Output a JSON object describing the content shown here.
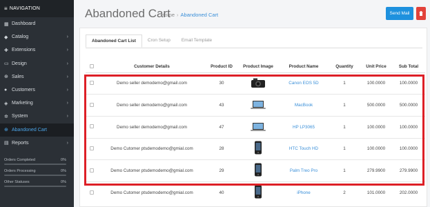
{
  "sidebar": {
    "header": "NAVIGATION",
    "items": [
      {
        "label": "Dashboard",
        "icon": "dashboard-icon",
        "chevron": false
      },
      {
        "label": "Catalog",
        "icon": "tag-icon",
        "chevron": true
      },
      {
        "label": "Extensions",
        "icon": "puzzle-icon",
        "chevron": true
      },
      {
        "label": "Design",
        "icon": "monitor-icon",
        "chevron": true
      },
      {
        "label": "Sales",
        "icon": "cart-icon",
        "chevron": true
      },
      {
        "label": "Customers",
        "icon": "user-icon",
        "chevron": true
      },
      {
        "label": "Marketing",
        "icon": "share-icon",
        "chevron": true
      },
      {
        "label": "System",
        "icon": "gear-icon",
        "chevron": true
      },
      {
        "label": "Abandoned Cart",
        "icon": "cart-icon",
        "chevron": false
      },
      {
        "label": "Reports",
        "icon": "chart-icon",
        "chevron": true
      }
    ],
    "stats": [
      {
        "label": "Orders Completed",
        "value": "0%"
      },
      {
        "label": "Orders Processing",
        "value": "0%"
      },
      {
        "label": "Other Statuses",
        "value": "0%"
      }
    ]
  },
  "header": {
    "title": "Abandoned Cart",
    "breadcrumb_home": "Home",
    "breadcrumb_sep": "›",
    "breadcrumb_current": "Abandoned Cart",
    "send_mail_label": "Send Mail"
  },
  "tabs": [
    "Abandoned Cart List",
    "Cron Setup",
    "Email Template"
  ],
  "table": {
    "headers": [
      "Customer Details",
      "Product ID",
      "Product Image",
      "Product Name",
      "Quantity",
      "Unit Price",
      "Sub Total"
    ],
    "rows": [
      {
        "customer": "Demo seller demodemo@gmail.com",
        "product_id": "30",
        "image": "camera-icon",
        "name": "Canon EOS 5D",
        "qty": "1",
        "unit": "100.0000",
        "sub": "100.0000"
      },
      {
        "customer": "Demo seller demodemo@gmail.com",
        "product_id": "43",
        "image": "laptop-icon",
        "name": "MacBook",
        "qty": "1",
        "unit": "500.0000",
        "sub": "500.0000"
      },
      {
        "customer": "Demo seller demodemo@gmail.com",
        "product_id": "47",
        "image": "laptop-icon",
        "name": "HP LP3065",
        "qty": "1",
        "unit": "100.0000",
        "sub": "100.0000"
      },
      {
        "customer": "Demo Cutomer ptsdemodemo@gmial.com",
        "product_id": "28",
        "image": "phone-icon",
        "name": "HTC Touch HD",
        "qty": "1",
        "unit": "100.0000",
        "sub": "100.0000"
      },
      {
        "customer": "Demo Cutomer ptsdemodemo@gmial.com",
        "product_id": "29",
        "image": "phone-icon",
        "name": "Palm Treo Pro",
        "qty": "1",
        "unit": "279.9900",
        "sub": "279.9900"
      },
      {
        "customer": "Demo Cutomer ptsdemodemo@gmial.com",
        "product_id": "40",
        "image": "phone-icon",
        "name": "iPhone",
        "qty": "2",
        "unit": "101.0000",
        "sub": "202.0000"
      }
    ]
  },
  "colors": {
    "sidebar_bg": "#2b3036",
    "accent": "#1e91de",
    "danger": "#e2423a",
    "highlight_box": "#dd1f26"
  }
}
